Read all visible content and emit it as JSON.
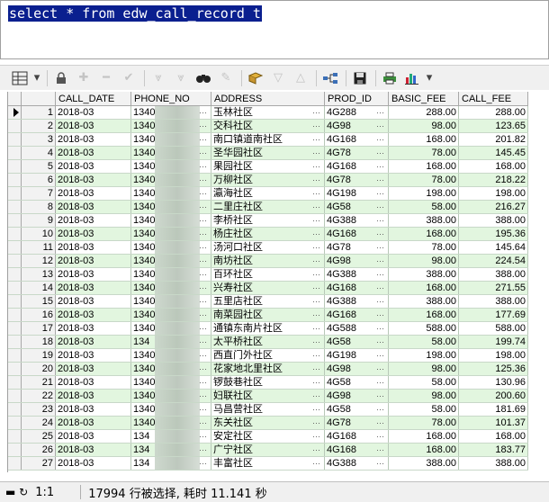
{
  "editor": {
    "sql": "select * from edw_call_record t"
  },
  "toolbar": {
    "icons": [
      "grid-icon",
      "lock-icon",
      "plus-icon",
      "minus-icon",
      "check-icon",
      "double-arrow-down-icon",
      "double-arrow-down-alt-icon",
      "binoculars-icon",
      "eraser-icon",
      "query-icon",
      "arrow-down-icon",
      "arrow-up-icon",
      "network-icon",
      "save-icon",
      "print-icon",
      "chart-icon"
    ]
  },
  "grid": {
    "columns": [
      "CALL_DATE",
      "PHONE_NO",
      "ADDRESS",
      "PROD_ID",
      "BASIC_FEE",
      "CALL_FEE"
    ],
    "rows": [
      {
        "n": "1",
        "date": "2018-03",
        "phone": "1340",
        "addr": "玉林社区",
        "prod": "4G288",
        "basic": "288.00",
        "call": "288.00"
      },
      {
        "n": "2",
        "date": "2018-03",
        "phone": "1340",
        "addr": "交科社区",
        "prod": "4G98",
        "basic": "98.00",
        "call": "123.65"
      },
      {
        "n": "3",
        "date": "2018-03",
        "phone": "1340",
        "addr": "南口镇道南社区",
        "prod": "4G168",
        "basic": "168.00",
        "call": "201.82"
      },
      {
        "n": "4",
        "date": "2018-03",
        "phone": "1340",
        "addr": "圣华园社区",
        "prod": "4G78",
        "basic": "78.00",
        "call": "145.45"
      },
      {
        "n": "5",
        "date": "2018-03",
        "phone": "1340",
        "addr": "果园社区",
        "prod": "4G168",
        "basic": "168.00",
        "call": "168.00"
      },
      {
        "n": "6",
        "date": "2018-03",
        "phone": "1340",
        "addr": "万柳社区",
        "prod": "4G78",
        "basic": "78.00",
        "call": "218.22"
      },
      {
        "n": "7",
        "date": "2018-03",
        "phone": "1340",
        "addr": "瀛海社区",
        "prod": "4G198",
        "basic": "198.00",
        "call": "198.00"
      },
      {
        "n": "8",
        "date": "2018-03",
        "phone": "1340",
        "addr": "二里庄社区",
        "prod": "4G58",
        "basic": "58.00",
        "call": "216.27"
      },
      {
        "n": "9",
        "date": "2018-03",
        "phone": "1340",
        "addr": "李桥社区",
        "prod": "4G388",
        "basic": "388.00",
        "call": "388.00"
      },
      {
        "n": "10",
        "date": "2018-03",
        "phone": "1340",
        "addr": "杨庄社区",
        "prod": "4G168",
        "basic": "168.00",
        "call": "195.36"
      },
      {
        "n": "11",
        "date": "2018-03",
        "phone": "1340",
        "addr": "汤河口社区",
        "prod": "4G78",
        "basic": "78.00",
        "call": "145.64"
      },
      {
        "n": "12",
        "date": "2018-03",
        "phone": "1340",
        "addr": "南坊社区",
        "prod": "4G98",
        "basic": "98.00",
        "call": "224.54"
      },
      {
        "n": "13",
        "date": "2018-03",
        "phone": "1340",
        "addr": "百环社区",
        "prod": "4G388",
        "basic": "388.00",
        "call": "388.00"
      },
      {
        "n": "14",
        "date": "2018-03",
        "phone": "1340",
        "addr": "兴寿社区",
        "prod": "4G168",
        "basic": "168.00",
        "call": "271.55"
      },
      {
        "n": "15",
        "date": "2018-03",
        "phone": "1340",
        "addr": "五里店社区",
        "prod": "4G388",
        "basic": "388.00",
        "call": "388.00"
      },
      {
        "n": "16",
        "date": "2018-03",
        "phone": "1340",
        "addr": "南菜园社区",
        "prod": "4G168",
        "basic": "168.00",
        "call": "177.69"
      },
      {
        "n": "17",
        "date": "2018-03",
        "phone": "1340",
        "addr": "通镇东南片社区",
        "prod": "4G588",
        "basic": "588.00",
        "call": "588.00"
      },
      {
        "n": "18",
        "date": "2018-03",
        "phone": "134",
        "addr": "太平桥社区",
        "prod": "4G58",
        "basic": "58.00",
        "call": "199.74"
      },
      {
        "n": "19",
        "date": "2018-03",
        "phone": "1340",
        "addr": "西直门外社区",
        "prod": "4G198",
        "basic": "198.00",
        "call": "198.00"
      },
      {
        "n": "20",
        "date": "2018-03",
        "phone": "1340",
        "addr": "花家地北里社区",
        "prod": "4G98",
        "basic": "98.00",
        "call": "125.36"
      },
      {
        "n": "21",
        "date": "2018-03",
        "phone": "1340",
        "addr": "锣鼓巷社区",
        "prod": "4G58",
        "basic": "58.00",
        "call": "130.96"
      },
      {
        "n": "22",
        "date": "2018-03",
        "phone": "1340",
        "addr": "妇联社区",
        "prod": "4G98",
        "basic": "98.00",
        "call": "200.60"
      },
      {
        "n": "23",
        "date": "2018-03",
        "phone": "1340",
        "addr": "马昌营社区",
        "prod": "4G58",
        "basic": "58.00",
        "call": "181.69"
      },
      {
        "n": "24",
        "date": "2018-03",
        "phone": "1340",
        "addr": "东关社区",
        "prod": "4G78",
        "basic": "78.00",
        "call": "101.37"
      },
      {
        "n": "25",
        "date": "2018-03",
        "phone": "134",
        "addr": "安定社区",
        "prod": "4G168",
        "basic": "168.00",
        "call": "168.00"
      },
      {
        "n": "26",
        "date": "2018-03",
        "phone": "134",
        "addr": "广宁社区",
        "prod": "4G168",
        "basic": "168.00",
        "call": "183.77"
      },
      {
        "n": "27",
        "date": "2018-03",
        "phone": "134",
        "addr": "丰富社区",
        "prod": "4G388",
        "basic": "388.00",
        "call": "388.00"
      }
    ]
  },
  "status": {
    "position": "1:1",
    "message": "17994 行被选择, 耗时 11.141 秒"
  },
  "colors": {
    "selection": "#0a1f8f",
    "row_alt": "#e2f6df"
  }
}
